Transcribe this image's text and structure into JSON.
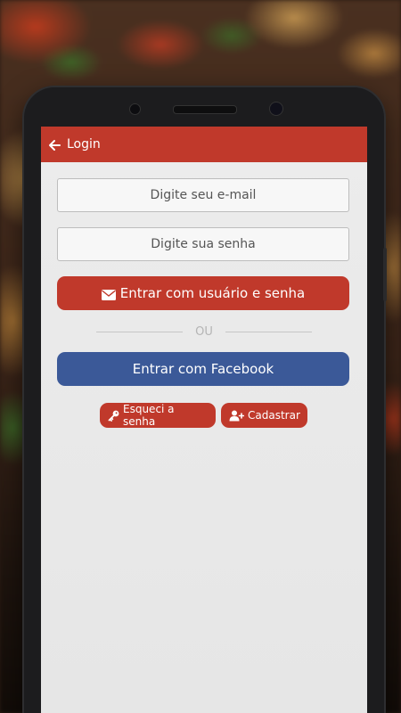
{
  "appbar": {
    "title": "Login",
    "back_icon": "arrow-left-icon"
  },
  "form": {
    "email_placeholder": "Digite seu e-mail",
    "email_value": "",
    "password_placeholder": "Digite sua senha",
    "password_value": ""
  },
  "actions": {
    "login_label": "Entrar com usuário e senha",
    "login_icon": "envelope-icon",
    "divider_label": "OU",
    "facebook_label": "Entrar com Facebook",
    "forgot_label": "Esqueci a senha",
    "forgot_icon": "key-icon",
    "register_label": "Cadastrar",
    "register_icon": "user-plus-icon"
  },
  "colors": {
    "primary": "#c0392b",
    "facebook": "#3b5998",
    "screen_bg": "#e8e8e8"
  }
}
